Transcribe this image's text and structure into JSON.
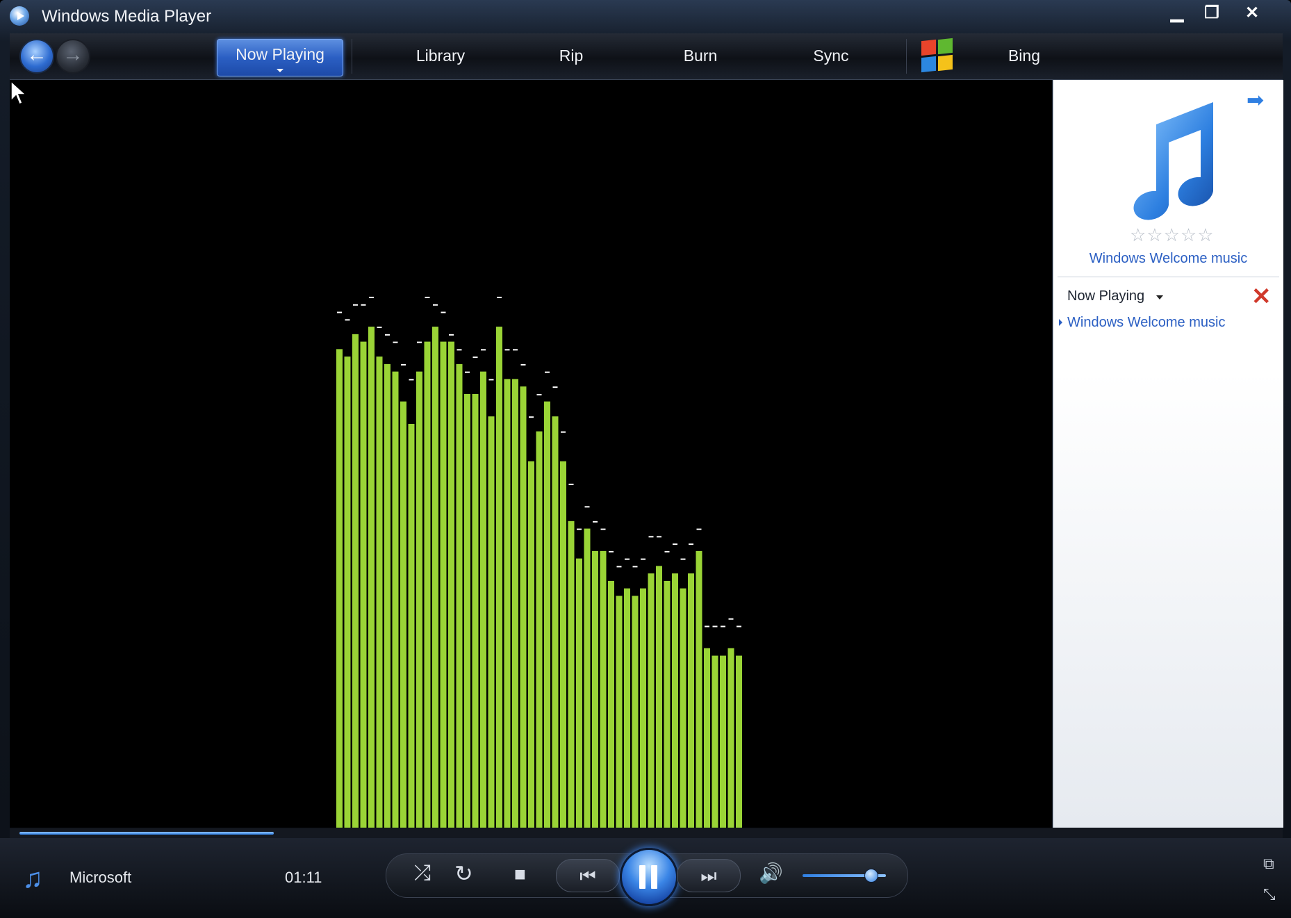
{
  "window": {
    "title": "Windows Media Player"
  },
  "titlebar": {
    "minimize": "▁",
    "maximize": "❐",
    "close": "✕"
  },
  "nav": {
    "tabs": [
      {
        "label": "Now Playing",
        "active": true
      },
      {
        "label": "Library"
      },
      {
        "label": "Rip"
      },
      {
        "label": "Burn"
      },
      {
        "label": "Sync"
      },
      {
        "label": "Bing"
      }
    ]
  },
  "visualizer": {
    "bar_color": "#9ad436",
    "peak_color": "#ffffff",
    "levels": [
      0.64,
      0.63,
      0.66,
      0.65,
      0.67,
      0.63,
      0.62,
      0.61,
      0.57,
      0.54,
      0.61,
      0.65,
      0.67,
      0.65,
      0.65,
      0.62,
      0.58,
      0.58,
      0.61,
      0.55,
      0.67,
      0.6,
      0.6,
      0.59,
      0.49,
      0.53,
      0.57,
      0.55,
      0.49,
      0.41,
      0.36,
      0.4,
      0.37,
      0.37,
      0.33,
      0.31,
      0.32,
      0.31,
      0.32,
      0.34,
      0.35,
      0.33,
      0.34,
      0.32,
      0.34,
      0.37,
      0.24,
      0.23,
      0.23,
      0.24,
      0.23
    ],
    "peaks": [
      0.69,
      0.68,
      0.7,
      0.7,
      0.71,
      0.67,
      0.66,
      0.65,
      0.62,
      0.6,
      0.65,
      0.71,
      0.7,
      0.69,
      0.66,
      0.64,
      0.61,
      0.63,
      0.64,
      0.6,
      0.71,
      0.64,
      0.64,
      0.62,
      0.55,
      0.58,
      0.61,
      0.59,
      0.53,
      0.46,
      0.4,
      0.43,
      0.41,
      0.4,
      0.37,
      0.35,
      0.36,
      0.35,
      0.36,
      0.39,
      0.39,
      0.37,
      0.38,
      0.36,
      0.38,
      0.4,
      0.27,
      0.27,
      0.27,
      0.28,
      0.27
    ]
  },
  "panel": {
    "rating_stars": "☆☆☆☆☆",
    "album_title": "Windows Welcome music",
    "now_playing_label": "Now Playing",
    "clear_icon": "✕",
    "playlist": [
      "Windows Welcome music"
    ]
  },
  "seek": {
    "progress": 0.2
  },
  "controls": {
    "artist": "Microsoft",
    "time": "01:11",
    "volume": 0.82,
    "shuffle_glyph": "⤮",
    "repeat_glyph": "↻",
    "stop_glyph": "■",
    "prev_glyph": "⏮",
    "next_glyph": "⏭",
    "volume_glyph": "🔊"
  },
  "colors": {
    "accent": "#2f7fe2",
    "viz_bar": "#9ad436"
  }
}
